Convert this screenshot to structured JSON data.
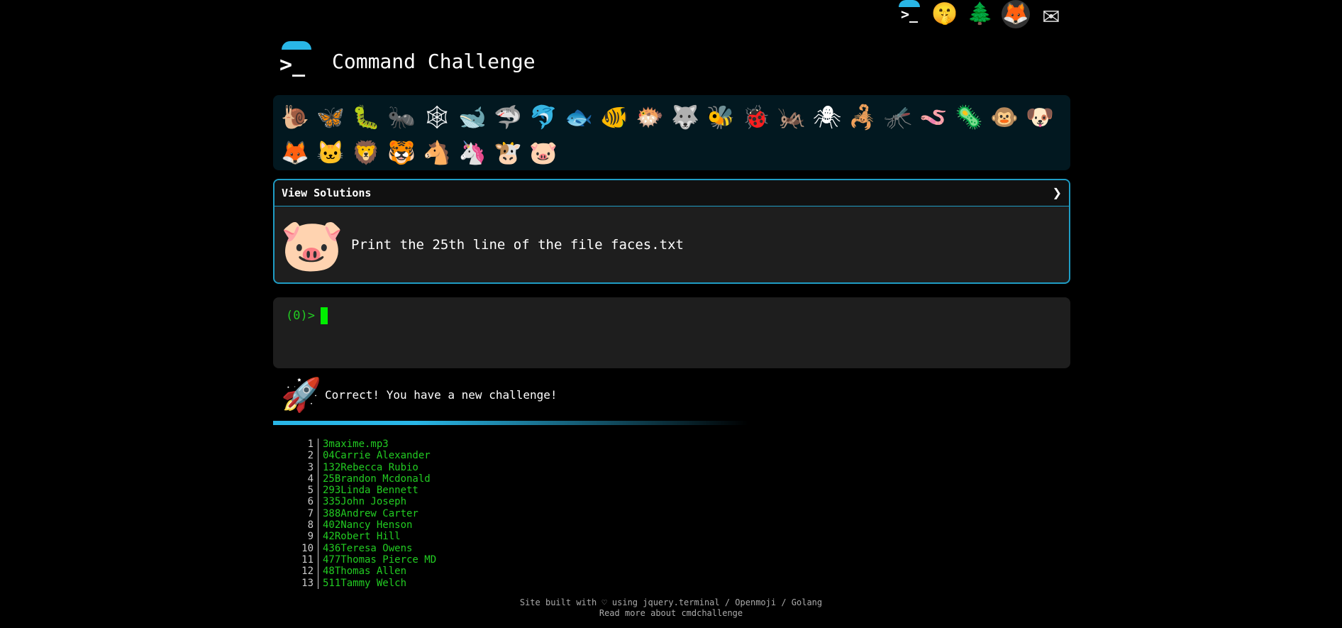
{
  "top_nav": {
    "icons": [
      {
        "name": "terminal-icon",
        "glyph": ">_"
      },
      {
        "name": "shushing-face-icon",
        "glyph": "🤫"
      },
      {
        "name": "tree-icon",
        "glyph": "🌲"
      },
      {
        "name": "gitlab-icon",
        "glyph": "🦊"
      },
      {
        "name": "mail-icon",
        "glyph": "✉"
      }
    ]
  },
  "header": {
    "logo_glyph": ">_",
    "title": "Command Challenge"
  },
  "challenge_emojis": {
    "row1": [
      "🐌",
      "🦋",
      "🐛",
      "🐜",
      "🕸",
      "🐋",
      "🦈",
      "🐬",
      "🐟",
      "🐠",
      "🐡",
      "🐺",
      "🐝",
      "🐞",
      "🦗",
      "🕷",
      "🦂",
      "🦟",
      "🪱",
      "🦠",
      "🐵",
      "🐶"
    ],
    "row2": [
      "🦊",
      "🐱",
      "🦁",
      "🐯",
      "🐴",
      "🦄",
      "🐮",
      "🐷"
    ]
  },
  "challenge": {
    "view_solutions_label": "View Solutions",
    "chevron": "❯",
    "emoji": "🐷",
    "description": "Print the 25th line of the file faces.txt"
  },
  "terminal": {
    "prompt": "(0)>"
  },
  "result": {
    "emoji": "🚀",
    "message": "Correct! You have a new challenge!"
  },
  "output_lines": [
    {
      "n": "1",
      "text": "3maxime.mp3"
    },
    {
      "n": "2",
      "text": "04Carrie Alexander"
    },
    {
      "n": "3",
      "text": "132Rebecca Rubio"
    },
    {
      "n": "4",
      "text": "25Brandon Mcdonald"
    },
    {
      "n": "5",
      "text": "293Linda Bennett"
    },
    {
      "n": "6",
      "text": "335John Joseph"
    },
    {
      "n": "7",
      "text": "388Andrew Carter"
    },
    {
      "n": "8",
      "text": "402Nancy Henson"
    },
    {
      "n": "9",
      "text": "42Robert Hill"
    },
    {
      "n": "10",
      "text": "436Teresa Owens"
    },
    {
      "n": "11",
      "text": "477Thomas Pierce MD"
    },
    {
      "n": "12",
      "text": "48Thomas Allen"
    },
    {
      "n": "13",
      "text": "511Tammy Welch"
    }
  ],
  "footer": {
    "line1": "Site built with ♡ using jquery.terminal / Openmoji / Golang",
    "line2": "Read more about cmdchallenge"
  },
  "colors": {
    "accent": "#29b6e6",
    "prompt_green": "#22cc22",
    "panel_bg": "#021820",
    "terminal_bg": "#1e1e1e"
  }
}
